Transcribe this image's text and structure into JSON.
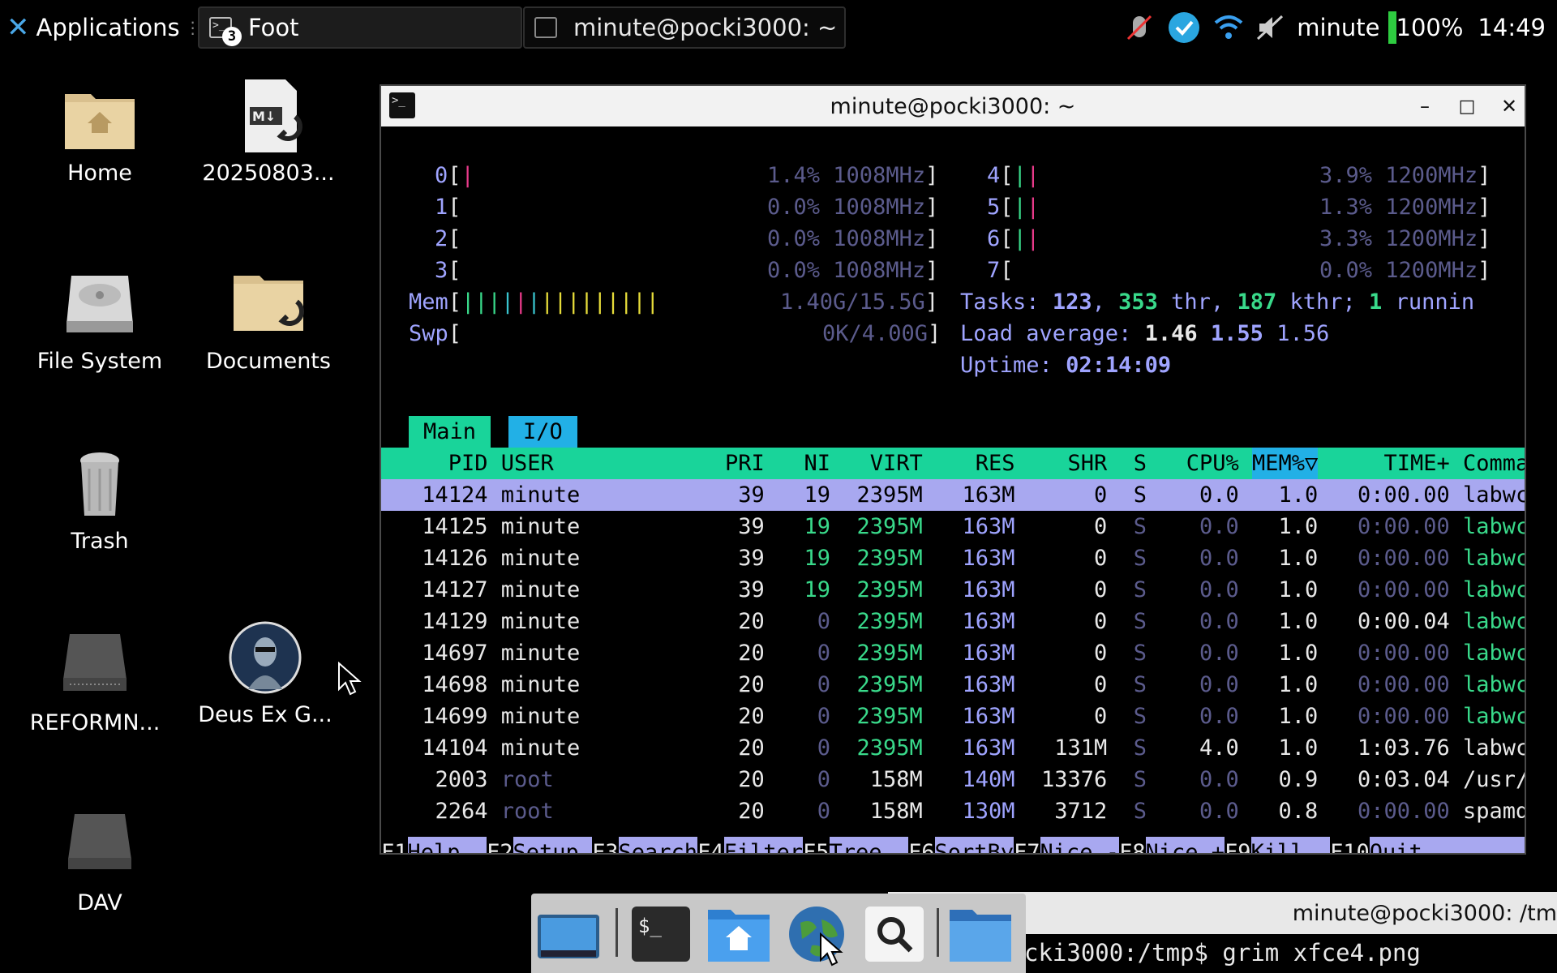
{
  "panel": {
    "applications": "Applications",
    "tasks": [
      {
        "title": "Foot",
        "badge": "3"
      },
      {
        "title": "minute@pocki3000: ~"
      }
    ],
    "user": "minute",
    "battery": "100%",
    "clock": "14:49",
    "tray_icons": [
      "mouse-disabled-icon",
      "kde-connect-icon",
      "wifi-icon",
      "volume-muted-icon",
      "battery-icon"
    ]
  },
  "desktop": {
    "icons": [
      {
        "label": "Home",
        "icon": "home-folder-icon"
      },
      {
        "label": "20250803...",
        "icon": "markdown-link-icon"
      },
      {
        "label": "File System",
        "icon": "hard-disk-icon"
      },
      {
        "label": "Documents",
        "icon": "folder-link-icon"
      },
      {
        "label": "Trash",
        "icon": "trash-icon"
      },
      {
        "label": "REFORMN...",
        "icon": "drive-icon"
      },
      {
        "label": "Deus Ex G...",
        "icon": "game-icon"
      },
      {
        "label": "DAV",
        "icon": "drive-icon"
      }
    ]
  },
  "window": {
    "title": "minute@pocki3000: ~",
    "buttons": [
      "minimize",
      "maximize",
      "close"
    ],
    "minimize_glyph": "–",
    "maximize_glyph": "□",
    "close_glyph": "✕"
  },
  "htop": {
    "cpus": [
      {
        "id": "0",
        "pct": "1.4%",
        "freq": "1008MHz"
      },
      {
        "id": "1",
        "pct": "0.0%",
        "freq": "1008MHz"
      },
      {
        "id": "2",
        "pct": "0.0%",
        "freq": "1008MHz"
      },
      {
        "id": "3",
        "pct": "0.0%",
        "freq": "1008MHz"
      },
      {
        "id": "4",
        "pct": "3.9%",
        "freq": "1200MHz"
      },
      {
        "id": "5",
        "pct": "1.3%",
        "freq": "1200MHz"
      },
      {
        "id": "6",
        "pct": "3.3%",
        "freq": "1200MHz"
      },
      {
        "id": "7",
        "pct": "0.0%",
        "freq": "1200MHz"
      }
    ],
    "mem": {
      "label": "Mem",
      "value": "1.40G/15.5G"
    },
    "swp": {
      "label": "Swp",
      "value": "0K/4.00G"
    },
    "tasks": {
      "label": "Tasks:",
      "tasks": "123",
      "thr": "353",
      "thr_label": "thr,",
      "kthr": "187",
      "kthr_label": "kthr;",
      "running": "1",
      "running_label": "runnin"
    },
    "load": {
      "label": "Load average:",
      "l1": "1.46",
      "l5": "1.55",
      "l15": "1.56"
    },
    "uptime": {
      "label": "Uptime:",
      "value": "02:14:09"
    },
    "tabs": [
      "Main",
      "I/O"
    ],
    "columns": [
      "PID",
      "USER",
      "PRI",
      "NI",
      "VIRT",
      "RES",
      "SHR",
      "S",
      "CPU%",
      "MEM%▽",
      "TIME+",
      "Command"
    ],
    "rows": [
      [
        "14124",
        "minute",
        "39",
        "19",
        "2395M",
        "163M",
        "0",
        "S",
        "0.0",
        "1.0",
        "0:00.00",
        "labwc --config-d"
      ],
      [
        "14125",
        "minute",
        "39",
        "19",
        "2395M",
        "163M",
        "0",
        "S",
        "0.0",
        "1.0",
        "0:00.00",
        "labwc --config-d"
      ],
      [
        "14126",
        "minute",
        "39",
        "19",
        "2395M",
        "163M",
        "0",
        "S",
        "0.0",
        "1.0",
        "0:00.00",
        "labwc --config-d"
      ],
      [
        "14127",
        "minute",
        "39",
        "19",
        "2395M",
        "163M",
        "0",
        "S",
        "0.0",
        "1.0",
        "0:00.00",
        "labwc --config-d"
      ],
      [
        "14129",
        "minute",
        "20",
        "0",
        "2395M",
        "163M",
        "0",
        "S",
        "0.0",
        "1.0",
        "0:00.04",
        "labwc --config-d"
      ],
      [
        "14697",
        "minute",
        "20",
        "0",
        "2395M",
        "163M",
        "0",
        "S",
        "0.0",
        "1.0",
        "0:00.00",
        "labwc --config-d"
      ],
      [
        "14698",
        "minute",
        "20",
        "0",
        "2395M",
        "163M",
        "0",
        "S",
        "0.0",
        "1.0",
        "0:00.00",
        "labwc --config-d"
      ],
      [
        "14699",
        "minute",
        "20",
        "0",
        "2395M",
        "163M",
        "0",
        "S",
        "0.0",
        "1.0",
        "0:00.00",
        "labwc --config-d"
      ],
      [
        "14104",
        "minute",
        "20",
        "0",
        "2395M",
        "163M",
        "131M",
        "S",
        "4.0",
        "1.0",
        "1:03.76",
        "labwc --config-d"
      ],
      [
        "2003",
        "root",
        "20",
        "0",
        "158M",
        "140M",
        "13376",
        "S",
        "0.0",
        "0.9",
        "0:03.04",
        "/usr/bin/perl -T"
      ],
      [
        "2264",
        "root",
        "20",
        "0",
        "158M",
        "130M",
        "3712",
        "S",
        "0.0",
        "0.8",
        "0:00.00",
        "spamd child"
      ]
    ],
    "fkeys": [
      {
        "key": "F1",
        "label": "Help"
      },
      {
        "key": "F2",
        "label": "Setup"
      },
      {
        "key": "F3",
        "label": "Search"
      },
      {
        "key": "F4",
        "label": "Filter"
      },
      {
        "key": "F5",
        "label": "Tree"
      },
      {
        "key": "F6",
        "label": "SortBy"
      },
      {
        "key": "F7",
        "label": "Nice -"
      },
      {
        "key": "F8",
        "label": "Nice +"
      },
      {
        "key": "F9",
        "label": "Kill"
      },
      {
        "key": "F10",
        "label": "Quit"
      }
    ]
  },
  "dock": {
    "items": [
      "show-desktop-icon",
      "terminal-icon",
      "home-icon",
      "web-browser-icon",
      "search-icon",
      "files-icon"
    ]
  },
  "back_window": {
    "title": "minute@pocki3000: /tm",
    "command_line": "cki3000:/tmp$ grim xfce4.png"
  }
}
